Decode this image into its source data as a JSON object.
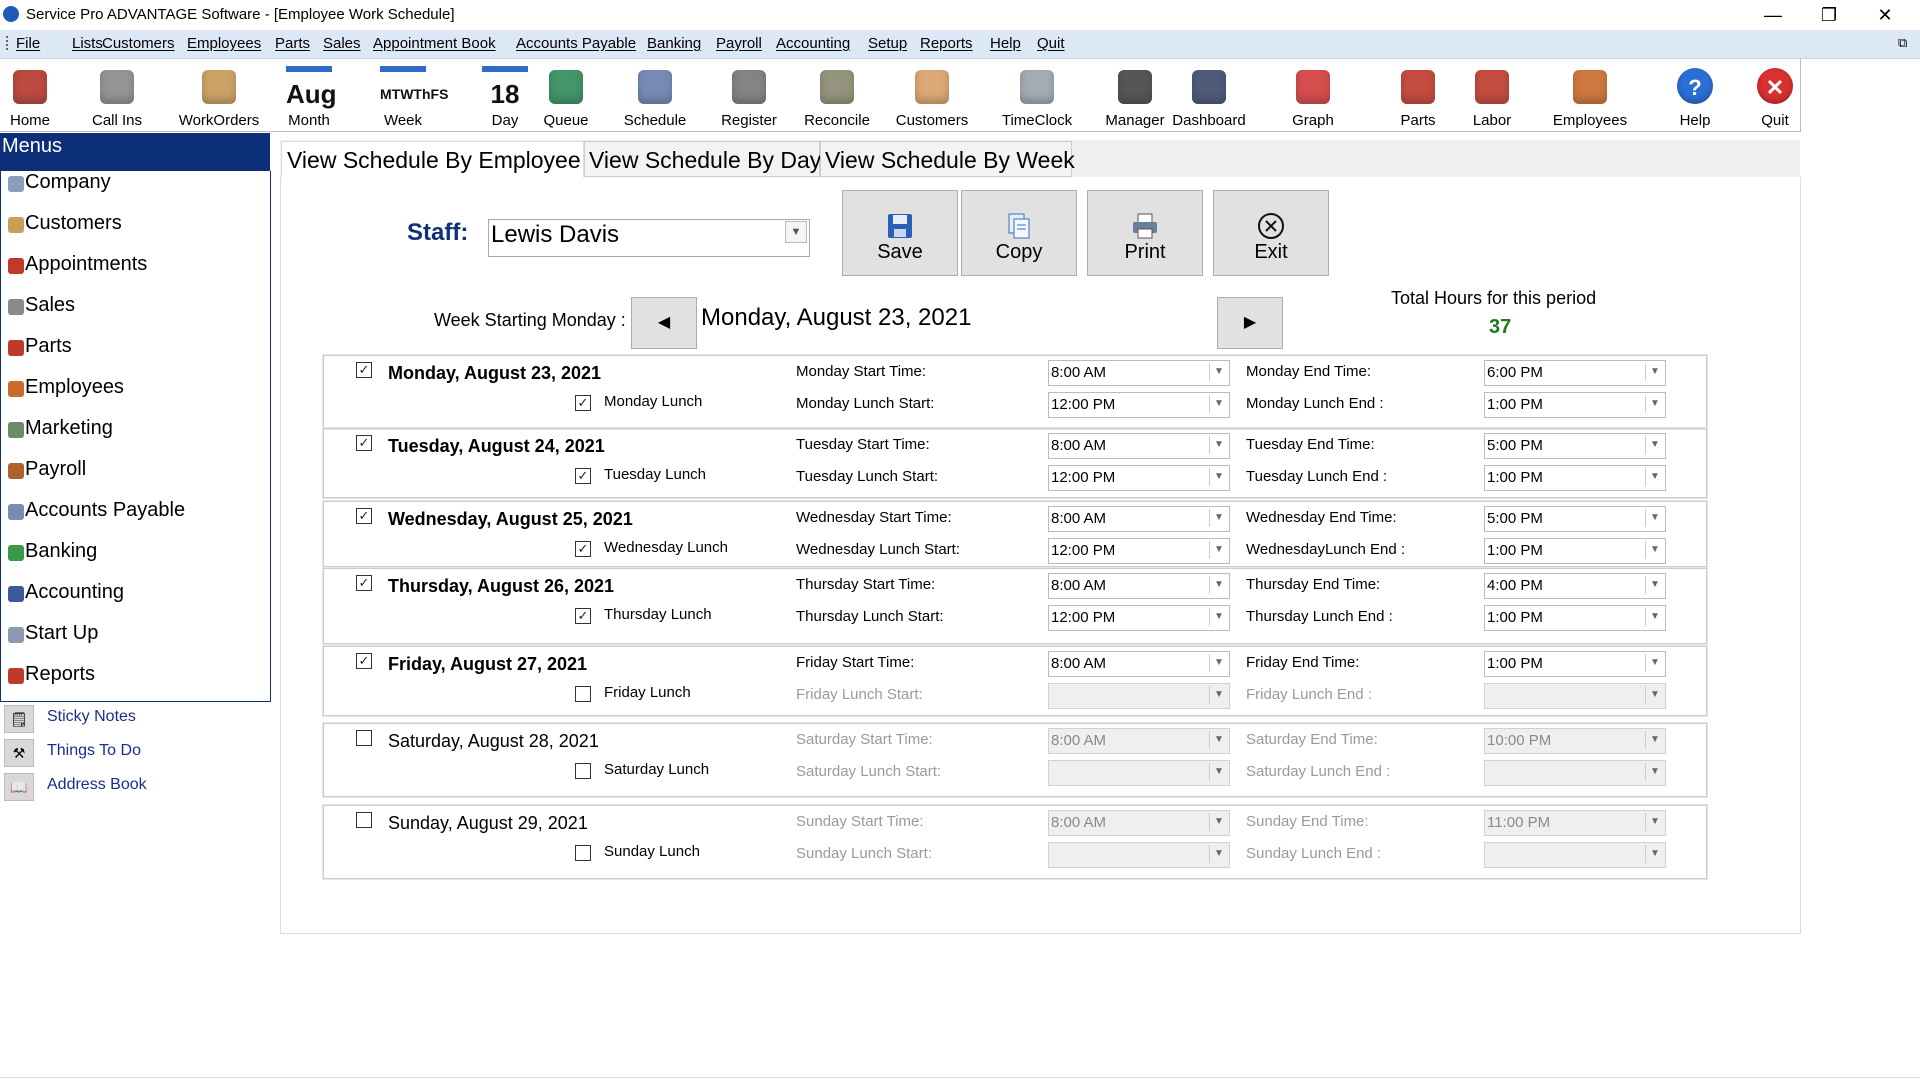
{
  "window": {
    "title": "Service Pro ADVANTAGE Software - [Employee Work Schedule]",
    "minimize": "—",
    "restore": "❐",
    "close": "✕",
    "mdi_restore": "⧉"
  },
  "menu": [
    "File",
    "Lists",
    "Customers",
    "Employees",
    "Parts",
    "Sales",
    "Appointment Book",
    "Accounts Payable",
    "Banking",
    "Payroll",
    "Accounting",
    "Setup",
    "Reports",
    "Help",
    "Quit"
  ],
  "toolbar": [
    {
      "label": "Home",
      "icon": "house-icon",
      "color": "#b5372b"
    },
    {
      "label": "Call Ins",
      "icon": "phone-icon",
      "color": "#8a8a8a"
    },
    {
      "label": "WorkOrders",
      "icon": "workorder-icon",
      "color": "#c79a55"
    },
    {
      "label": "Month",
      "icon": "calendar-month-icon",
      "text": "Aug",
      "color": "#2f6bc8"
    },
    {
      "label": "Week",
      "icon": "calendar-week-icon",
      "text": "MTWThFS",
      "color": "#2f6bc8"
    },
    {
      "label": "Day",
      "icon": "calendar-day-icon",
      "text": "18",
      "color": "#2f6bc8"
    },
    {
      "label": "Queue",
      "icon": "queue-icon",
      "color": "#2e8b57"
    },
    {
      "label": "Schedule",
      "icon": "schedule-icon",
      "color": "#6a7fb0"
    },
    {
      "label": "Register",
      "icon": "cash-register-icon",
      "color": "#777"
    },
    {
      "label": "Reconcile",
      "icon": "reconcile-icon",
      "color": "#8a8a70"
    },
    {
      "label": "Customers",
      "icon": "handshake-icon",
      "color": "#d9a066"
    },
    {
      "label": "TimeClock",
      "icon": "clock-icon",
      "color": "#9aa3ad"
    },
    {
      "label": "Manager",
      "icon": "manager-icon",
      "color": "#444"
    },
    {
      "label": "Dashboard",
      "icon": "dashboard-icon",
      "color": "#3b4a6b"
    },
    {
      "label": "Graph",
      "icon": "bar-graph-icon",
      "color": "#d23b3b"
    },
    {
      "label": "Parts",
      "icon": "parts-icon",
      "color": "#c0392b"
    },
    {
      "label": "Labor",
      "icon": "labor-icon",
      "color": "#c0392b"
    },
    {
      "label": "Employees",
      "icon": "employees-icon",
      "color": "#c96a2b"
    },
    {
      "label": "Help",
      "icon": "help-icon",
      "text": "?",
      "color": "#2b6fd6"
    },
    {
      "label": "Quit",
      "icon": "quit-icon",
      "text": "✕",
      "color": "#d93030"
    }
  ],
  "sidebar": {
    "header": "Menus",
    "items": [
      {
        "label": "Company",
        "icon": "company-icon",
        "color": "#8aa0b8"
      },
      {
        "label": "Customers",
        "icon": "customers-icon",
        "color": "#c9a05a"
      },
      {
        "label": "Appointments",
        "icon": "appointments-icon",
        "color": "#c0392b"
      },
      {
        "label": "Sales",
        "icon": "sales-icon",
        "color": "#8a8a8a"
      },
      {
        "label": "Parts",
        "icon": "parts-icon",
        "color": "#c0392b"
      },
      {
        "label": "Employees",
        "icon": "employees-icon",
        "color": "#c96a2b"
      },
      {
        "label": "Marketing",
        "icon": "marketing-icon",
        "color": "#6a8a6a"
      },
      {
        "label": "Payroll",
        "icon": "payroll-icon",
        "color": "#b0602b"
      },
      {
        "label": "Accounts Payable",
        "icon": "accounts-payable-icon",
        "color": "#7a8ab0"
      },
      {
        "label": "Banking",
        "icon": "banking-icon",
        "color": "#3a9a4a"
      },
      {
        "label": "Accounting",
        "icon": "accounting-icon",
        "color": "#3a5a9a"
      },
      {
        "label": "Start Up",
        "icon": "startup-icon",
        "color": "#8a9ab0"
      },
      {
        "label": "Reports",
        "icon": "reports-icon",
        "color": "#c0392b"
      }
    ],
    "tools": [
      {
        "label": "Sticky Notes",
        "icon": "sticky-note-icon",
        "glyph": "🗒"
      },
      {
        "label": "Things To Do",
        "icon": "hammer-icon",
        "glyph": "⚒"
      },
      {
        "label": "Address Book",
        "icon": "address-book-icon",
        "glyph": "📖"
      }
    ]
  },
  "tabs": {
    "active": "View  Schedule By Employee",
    "day": "View Schedule By Day",
    "week": "View Schedule By Week"
  },
  "staff": {
    "label": "Staff:",
    "value": "Lewis Davis"
  },
  "buttons": {
    "save": "Save",
    "copy": "Copy",
    "print": "Print",
    "exit": "Exit"
  },
  "week": {
    "label": "Week Starting Monday :",
    "date": "Monday, August 23, 2021",
    "prev": "◀",
    "next": "▶"
  },
  "totals": {
    "label": "Total Hours for this period",
    "value": "37"
  },
  "days": [
    {
      "checked": true,
      "name": "Monday, August 23, 2021",
      "bold": true,
      "lunch_checked": true,
      "lunch_label": "Monday Lunch",
      "start_label": "Monday Start Time:",
      "start": "8:00 AM",
      "end_label": "Monday End Time:",
      "end": "6:00 PM",
      "lstart_label": "Monday Lunch Start:",
      "lstart": "12:00 PM",
      "lend_label": "Monday Lunch End :",
      "lend": "1:00 PM",
      "enabled": true,
      "lunch_enabled": true
    },
    {
      "checked": true,
      "name": "Tuesday, August 24, 2021",
      "bold": true,
      "lunch_checked": true,
      "lunch_label": "Tuesday Lunch",
      "start_label": "Tuesday Start Time:",
      "start": "8:00 AM",
      "end_label": "Tuesday End Time:",
      "end": "5:00 PM",
      "lstart_label": "Tuesday Lunch Start:",
      "lstart": "12:00 PM",
      "lend_label": "Tuesday Lunch End :",
      "lend": "1:00 PM",
      "enabled": true,
      "lunch_enabled": true
    },
    {
      "checked": true,
      "name": "Wednesday, August 25, 2021",
      "bold": true,
      "lunch_checked": true,
      "lunch_label": "Wednesday Lunch",
      "start_label": "Wednesday Start Time:",
      "start": "8:00 AM",
      "end_label": "Wednesday End Time:",
      "end": "5:00 PM",
      "lstart_label": "Wednesday Lunch Start:",
      "lstart": "12:00 PM",
      "lend_label": "WednesdayLunch End :",
      "lend": "1:00 PM",
      "enabled": true,
      "lunch_enabled": true
    },
    {
      "checked": true,
      "name": "Thursday, August 26, 2021",
      "bold": true,
      "lunch_checked": true,
      "lunch_label": "Thursday Lunch",
      "start_label": "Thursday Start Time:",
      "start": "8:00 AM",
      "end_label": "Thursday End Time:",
      "end": "4:00 PM",
      "lstart_label": "Thursday Lunch Start:",
      "lstart": "12:00 PM",
      "lend_label": "Thursday Lunch End :",
      "lend": "1:00 PM",
      "enabled": true,
      "lunch_enabled": true
    },
    {
      "checked": true,
      "name": "Friday, August 27, 2021",
      "bold": true,
      "lunch_checked": false,
      "lunch_label": "Friday Lunch",
      "start_label": "Friday Start Time:",
      "start": "8:00 AM",
      "end_label": "Friday End Time:",
      "end": "1:00 PM",
      "lstart_label": "Friday Lunch Start:",
      "lstart": "",
      "lend_label": "Friday Lunch End :",
      "lend": "",
      "enabled": true,
      "lunch_enabled": false
    },
    {
      "checked": false,
      "name": "Saturday, August 28, 2021",
      "bold": false,
      "lunch_checked": false,
      "lunch_label": "Saturday Lunch",
      "start_label": "Saturday Start Time:",
      "start": "8:00 AM",
      "end_label": "Saturday End Time:",
      "end": "10:00 PM",
      "lstart_label": "Saturday Lunch Start:",
      "lstart": "",
      "lend_label": "Saturday Lunch End :",
      "lend": "",
      "enabled": false,
      "lunch_enabled": false
    },
    {
      "checked": false,
      "name": "Sunday, August 29, 2021",
      "bold": false,
      "lunch_checked": false,
      "lunch_label": "Sunday Lunch",
      "start_label": "Sunday Start Time:",
      "start": "8:00 AM",
      "end_label": "Sunday End Time:",
      "end": "11:00 PM",
      "lstart_label": "Sunday Lunch Start:",
      "lstart": "",
      "lend_label": "Sunday Lunch End :",
      "lend": "",
      "enabled": false,
      "lunch_enabled": false
    }
  ]
}
